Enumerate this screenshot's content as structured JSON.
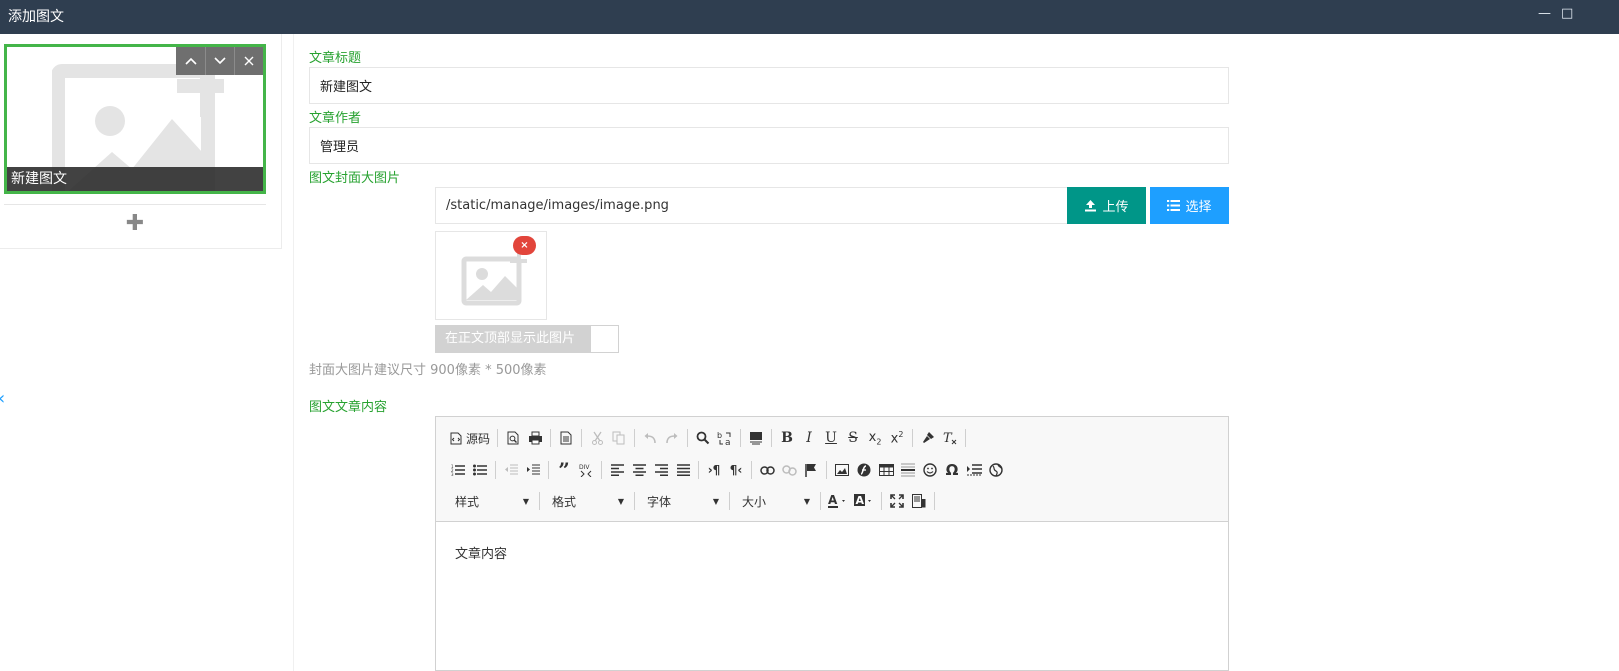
{
  "window": {
    "title": "添加图文",
    "minimize_glyph": "—",
    "maximize_glyph": "□"
  },
  "articles": {
    "items": [
      {
        "caption": "新建图文",
        "selected": true
      }
    ],
    "controls": [
      "chevron-up-icon",
      "chevron-down-icon",
      "close-icon"
    ],
    "add_glyph": "✚",
    "collapse_glyph": "‹"
  },
  "form": {
    "title_label": "文章标题",
    "title_value": "新建图文",
    "author_label": "文章作者",
    "author_value": "管理员",
    "cover_label": "图文封面大图片",
    "cover_path": "/static/manage/images/image.png",
    "upload_label": "上传",
    "select_label": "选择",
    "remove_glyph": "×",
    "show_in_body_label": "在正文顶部显示此图片",
    "cover_hint": "封面大图片建议尺寸 900像素 * 500像素",
    "content_label": "图文文章内容"
  },
  "editor": {
    "source_label": "源码",
    "combos": {
      "style": "样式",
      "format": "格式",
      "font": "字体",
      "size": "大小"
    },
    "content_text": "文章内容"
  },
  "colors": {
    "titlebar": "#2f3e50",
    "accent_green": "#27a230",
    "selected_border": "#44b549",
    "upload": "#009688",
    "select": "#1e9fff",
    "remove": "#e2453b"
  }
}
